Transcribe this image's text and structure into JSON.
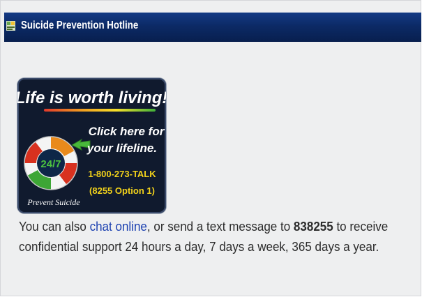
{
  "header": {
    "title": "Suicide Prevention Hotline",
    "icon": "page-icon"
  },
  "banner": {
    "headline": "Life is worth living!",
    "cta_line1": "Click here for",
    "cta_line2": "your lifeline.",
    "phone": "1-800-273-TALK",
    "phone_option": "(8255 Option 1)",
    "ring_label": "24/7",
    "footer": "Prevent Suicide",
    "colors": {
      "background": "#101a2e",
      "cta_text": "#ffffff",
      "phone_text": "#f2d21b",
      "arrow": "#49b83a",
      "ring_white": "#f4f4f4",
      "ring_red": "#d8311f",
      "ring_orange": "#e98a1c",
      "ring_green": "#3da635"
    }
  },
  "message": {
    "line1_before": "You can also ",
    "chat_link": "chat online",
    "line1_middle": ", or send a text message to ",
    "text_number": "838255",
    "line1_after": " to receive",
    "line2": "confidential support 24 hours a day, 7 days a week, 365 days a year."
  }
}
